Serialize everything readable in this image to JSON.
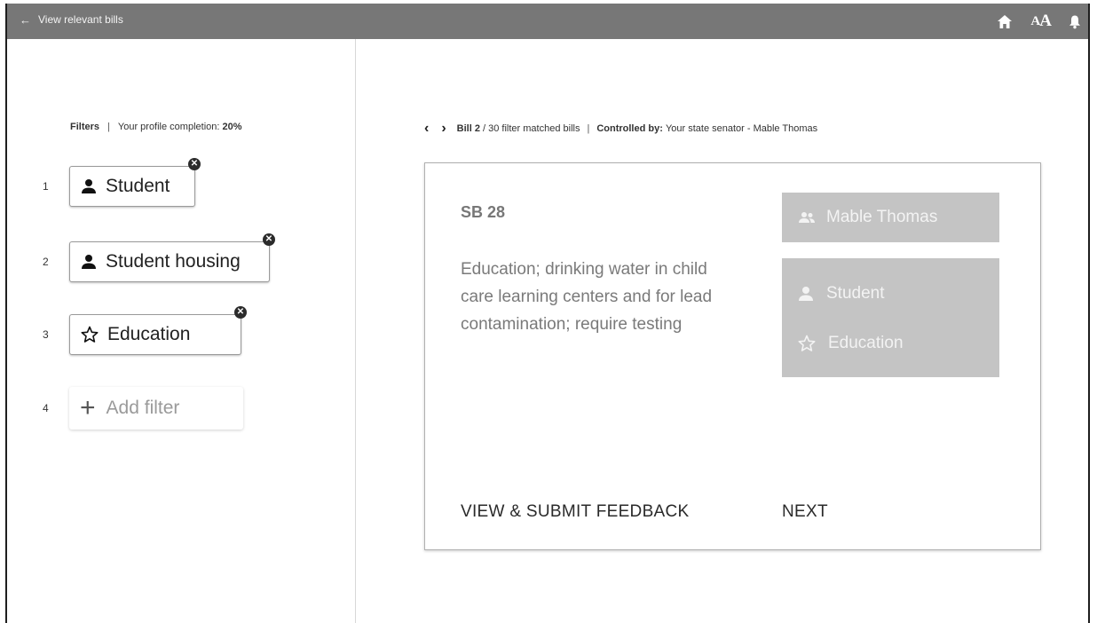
{
  "header": {
    "back_label": "View relevant bills",
    "icons": [
      "back-arrow-icon",
      "home-icon",
      "font-size-icon",
      "bell-icon"
    ]
  },
  "filters_panel": {
    "title": "Filters",
    "separator": "|",
    "completion_label": "Your profile completion:",
    "completion_value": "20%",
    "items": [
      {
        "number": "1",
        "label": "Student",
        "icon": "person-icon"
      },
      {
        "number": "2",
        "label": "Student housing",
        "icon": "person-icon"
      },
      {
        "number": "3",
        "label": "Education",
        "icon": "star-outline-icon"
      }
    ],
    "add": {
      "number": "4",
      "label": "Add filter",
      "icon": "plus-icon"
    }
  },
  "bill_nav": {
    "bill_label": "Bill 2",
    "count_text": "/ 30 filter matched bills",
    "separator": "|",
    "controlled_label": "Controlled by:",
    "controlled_value": "Your state senator - Mable Thomas"
  },
  "bill_card": {
    "id": "SB 28",
    "description": "Education; drinking water in child care learning centers and for lead contamination; require testing",
    "sponsor": "Mable Thomas",
    "tags": [
      {
        "label": "Student",
        "icon": "person-icon"
      },
      {
        "label": "Education",
        "icon": "star-outline-icon"
      }
    ],
    "feedback_button": "VIEW & SUBMIT FEEDBACK",
    "next_button": "NEXT"
  },
  "colors": {
    "topbar": "#777777",
    "tag_box": "#c4c4c4",
    "card_text": "#7a7a7a"
  }
}
